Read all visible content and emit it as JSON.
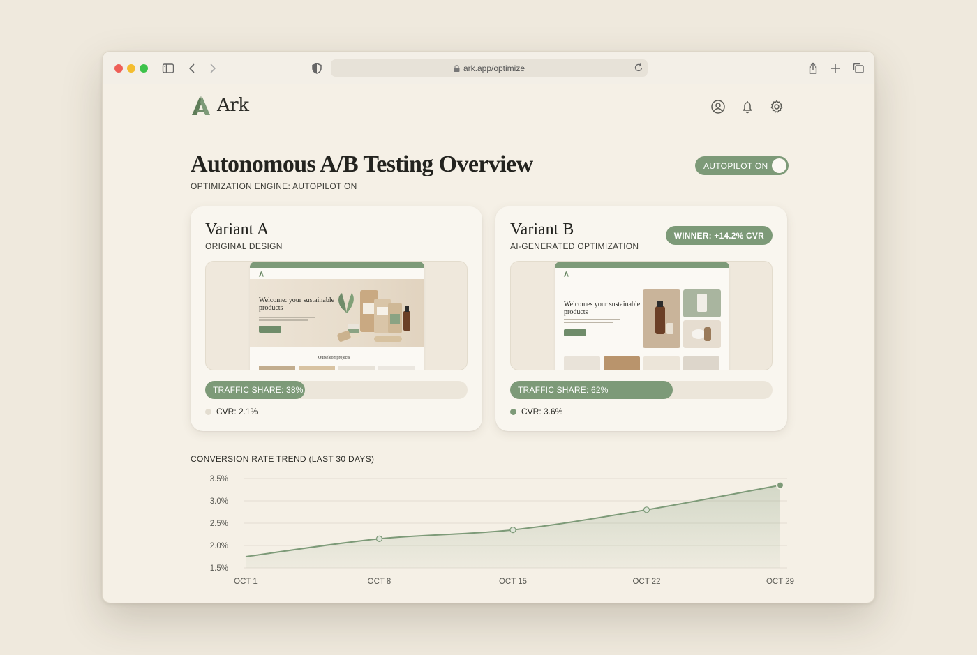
{
  "browser": {
    "url": "ark.app/optimize"
  },
  "app": {
    "brand": "Ark",
    "header_icons": [
      "user-circle-icon",
      "bell-icon",
      "gear-icon"
    ]
  },
  "page": {
    "title": "Autonomous A/B Testing Overview",
    "subtitle": "OPTIMIZATION ENGINE: AUTOPILOT ON",
    "autopilot_toggle": {
      "label": "AUTOPILOT ON",
      "on": true
    }
  },
  "variants": [
    {
      "title": "Variant A",
      "subtitle": "ORIGINAL DESIGN",
      "traffic_share_label": "TRAFFIC SHARE: 38%",
      "traffic_share": 0.38,
      "cvr_label": "CVR: 2.1%",
      "dot_color": "#e3ddd0",
      "preview": {
        "hero": "Welcome: your sustainable products",
        "section": "Ourseleomprojects"
      }
    },
    {
      "title": "Variant B",
      "subtitle": "AI-GENERATED OPTIMIZATION",
      "badge": "WINNER: +14.2% CVR",
      "traffic_share_label": "TRAFFIC SHARE: 62%",
      "traffic_share": 0.62,
      "cvr_label": "CVR: 3.6%",
      "dot_color": "#7d9a78",
      "preview": {
        "hero": "Welcomes your sustainable products"
      }
    }
  ],
  "colors": {
    "accent": "#7d9a78",
    "background": "#efe9dd",
    "window": "#f5f0e6"
  },
  "chart_data": {
    "type": "area",
    "title": "CONVERSION RATE TREND (LAST 30 DAYS)",
    "x": [
      "OCT 1",
      "OCT 8",
      "OCT 15",
      "OCT 22",
      "OCT 29"
    ],
    "y_ticks": [
      "3.5%",
      "3.0%",
      "2.5%",
      "2.0%",
      "1.5%"
    ],
    "series": [
      {
        "values": [
          1.75,
          2.15,
          2.35,
          2.8,
          3.35
        ]
      }
    ],
    "ylim": [
      1.5,
      3.5
    ],
    "grid": true,
    "marker_points": [
      1,
      2,
      3,
      4
    ]
  }
}
